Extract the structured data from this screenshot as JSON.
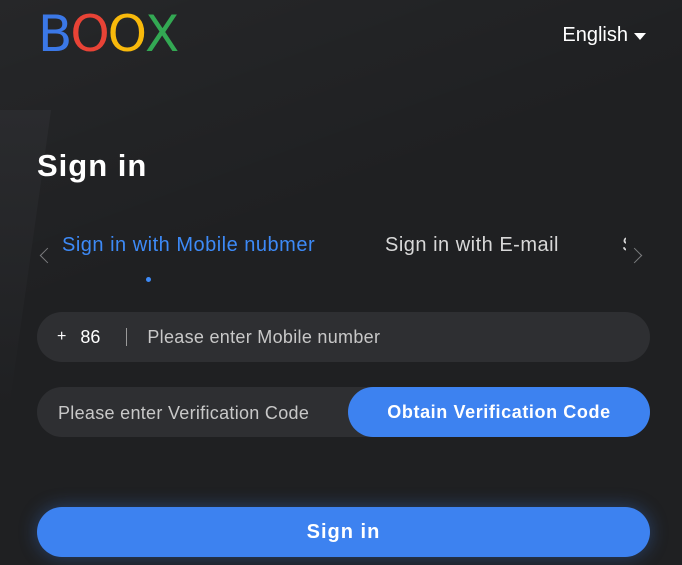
{
  "brand": {
    "letters": [
      "B",
      "O",
      "O",
      "X"
    ],
    "colors": [
      "#3b78e7",
      "#e84336",
      "#f8b90b",
      "#33a853"
    ]
  },
  "header": {
    "language": "English"
  },
  "page_title": "Sign in",
  "tabs": [
    {
      "label": "Sign in with Mobile nubmer",
      "active": true
    },
    {
      "label": "Sign in with E-mail",
      "active": false
    },
    {
      "label": "Sign in with Account",
      "active": false
    }
  ],
  "phone": {
    "plus": "+",
    "country_code": "86",
    "placeholder": "Please enter Mobile number"
  },
  "verification": {
    "placeholder": "Please enter Verification Code",
    "obtain_label": "Obtain Verification Code"
  },
  "submit_label": "Sign in",
  "colors": {
    "accent": "#3d82f0",
    "background": "#1f2022",
    "field": "#2e2f32"
  }
}
